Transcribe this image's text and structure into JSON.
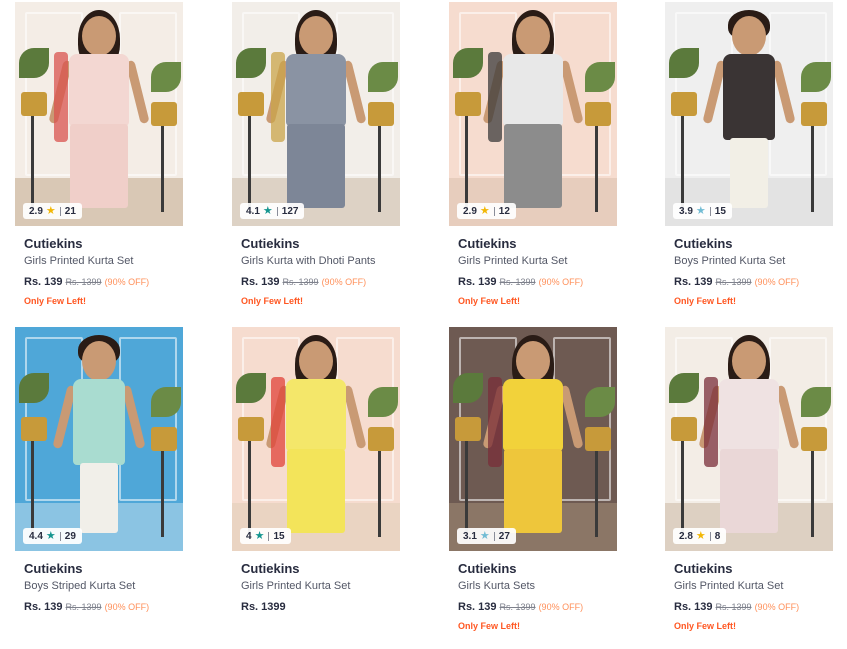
{
  "products": [
    {
      "brand": "Cutiekins",
      "name": "Girls Printed Kurta Set",
      "rating": "2.9",
      "reviews": "21",
      "star_color": "#f2b705",
      "price": "Rs. 139",
      "mrp": "Rs. 1399",
      "discount": "(90% OFF)",
      "stock": "Only Few Left!",
      "colors": {
        "wall": "#f4ede6",
        "floor": "#d9c8b5",
        "top": "#f3d7d2",
        "pants": "#f0cfc9",
        "accent": "#d9534f"
      }
    },
    {
      "brand": "Cutiekins",
      "name": "Girls Kurta with Dhoti Pants",
      "rating": "4.1",
      "reviews": "127",
      "star_color": "#14958f",
      "price": "Rs. 139",
      "mrp": "Rs. 1399",
      "discount": "(90% OFF)",
      "stock": "Only Few Left!",
      "colors": {
        "wall": "#f2eee9",
        "floor": "#ddd2c5",
        "top": "#8a93a3",
        "pants": "#7d8697",
        "accent": "#c9a44a"
      }
    },
    {
      "brand": "Cutiekins",
      "name": "Girls Printed Kurta Set",
      "rating": "2.9",
      "reviews": "12",
      "star_color": "#f2b705",
      "price": "Rs. 139",
      "mrp": "Rs. 1399",
      "discount": "(90% OFF)",
      "stock": "Only Few Left!",
      "colors": {
        "wall": "#f6dccf",
        "floor": "#e7cdbd",
        "top": "#e8e8e8",
        "pants": "#8c8c8c",
        "accent": "#3b3b3b"
      }
    },
    {
      "brand": "Cutiekins",
      "name": "Boys Printed Kurta Set",
      "rating": "3.9",
      "reviews": "15",
      "star_color": "#72bcd4",
      "price": "Rs. 139",
      "mrp": "Rs. 1399",
      "discount": "(90% OFF)",
      "stock": "Only Few Left!",
      "colors": {
        "wall": "#efefef",
        "floor": "#e3e3e3",
        "top": "#3a3434",
        "pants": "#f2efe6",
        "accent": "#b9424a"
      }
    },
    {
      "brand": "Cutiekins",
      "name": "Boys Striped Kurta Set",
      "rating": "4.4",
      "reviews": "29",
      "star_color": "#14958f",
      "price": "Rs. 139",
      "mrp": "Rs. 1399",
      "discount": "(90% OFF)",
      "stock": "",
      "colors": {
        "wall": "#4fa7d8",
        "floor": "#8bc4e3",
        "top": "#a9dcd0",
        "pants": "#f1efe9",
        "accent": "#6b4a2e"
      }
    },
    {
      "brand": "Cutiekins",
      "name": "Girls Printed Kurta Set",
      "rating": "4",
      "reviews": "15",
      "star_color": "#14958f",
      "price": "Rs. 1399",
      "mrp": "",
      "discount": "",
      "stock": "",
      "colors": {
        "wall": "#f6dccf",
        "floor": "#ead4c2",
        "top": "#f4e76a",
        "pants": "#f3e45a",
        "accent": "#e0433a"
      }
    },
    {
      "brand": "Cutiekins",
      "name": "Girls Kurta Sets",
      "rating": "3.1",
      "reviews": "27",
      "star_color": "#72bcd4",
      "price": "Rs. 139",
      "mrp": "Rs. 1399",
      "discount": "(90% OFF)",
      "stock": "Only Few Left!",
      "colors": {
        "wall": "#6e5a52",
        "floor": "#8b7666",
        "top": "#f2d23a",
        "pants": "#eec63b",
        "accent": "#7a2f3a"
      }
    },
    {
      "brand": "Cutiekins",
      "name": "Girls Printed Kurta Set",
      "rating": "2.8",
      "reviews": "8",
      "star_color": "#f2b705",
      "price": "Rs. 139",
      "mrp": "Rs. 1399",
      "discount": "(90% OFF)",
      "stock": "Only Few Left!",
      "colors": {
        "wall": "#f3ede6",
        "floor": "#ddd0c2",
        "top": "#efe2e2",
        "pants": "#ead7d7",
        "accent": "#7a2e3a"
      }
    }
  ]
}
